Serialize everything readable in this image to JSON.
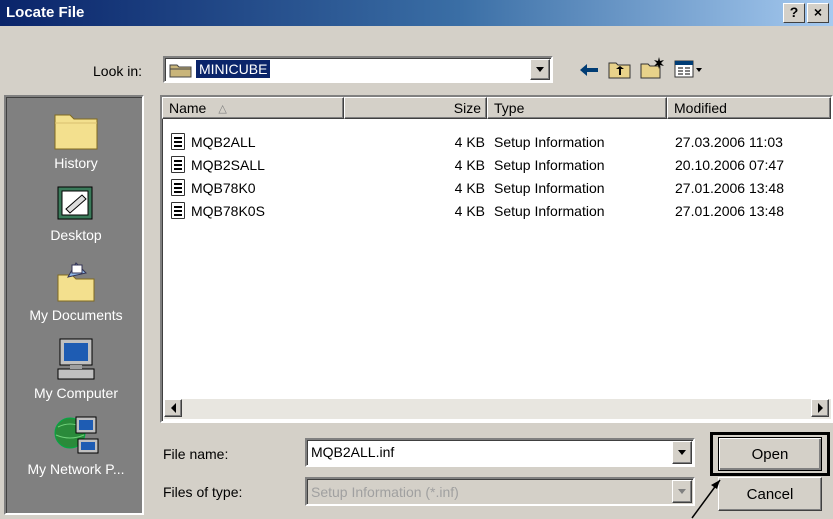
{
  "window": {
    "title": "Locate File",
    "help_label": "?",
    "close_label": "×"
  },
  "look_in": {
    "label": "Look in:",
    "value": "MINICUBE"
  },
  "toolbar": {
    "back_icon": "back-arrow-icon",
    "up_icon": "up-folder-icon",
    "new_folder_icon": "new-folder-icon",
    "view_menu_icon": "view-menu-icon"
  },
  "places": [
    {
      "label": "History",
      "icon": "history-icon"
    },
    {
      "label": "Desktop",
      "icon": "desktop-icon"
    },
    {
      "label": "My Documents",
      "icon": "my-documents-icon"
    },
    {
      "label": "My Computer",
      "icon": "my-computer-icon"
    },
    {
      "label": "My Network P...",
      "icon": "network-places-icon"
    }
  ],
  "columns": {
    "name": "Name",
    "size": "Size",
    "type": "Type",
    "modified": "Modified",
    "sort_indicator": "△"
  },
  "files": [
    {
      "name": "MQB2ALL",
      "size": "4 KB",
      "type": "Setup Information",
      "modified": "27.03.2006 11:03"
    },
    {
      "name": "MQB2SALL",
      "size": "4 KB",
      "type": "Setup Information",
      "modified": "20.10.2006 07:47"
    },
    {
      "name": "MQB78K0",
      "size": "4 KB",
      "type": "Setup Information",
      "modified": "27.01.2006 13:48"
    },
    {
      "name": "MQB78K0S",
      "size": "4 KB",
      "type": "Setup Information",
      "modified": "27.01.2006 13:48"
    }
  ],
  "file_name": {
    "label": "File name:",
    "value": "MQB2ALL.inf"
  },
  "file_type": {
    "label": "Files of type:",
    "value": "Setup Information (*.inf)"
  },
  "buttons": {
    "open": "Open",
    "cancel": "Cancel"
  }
}
